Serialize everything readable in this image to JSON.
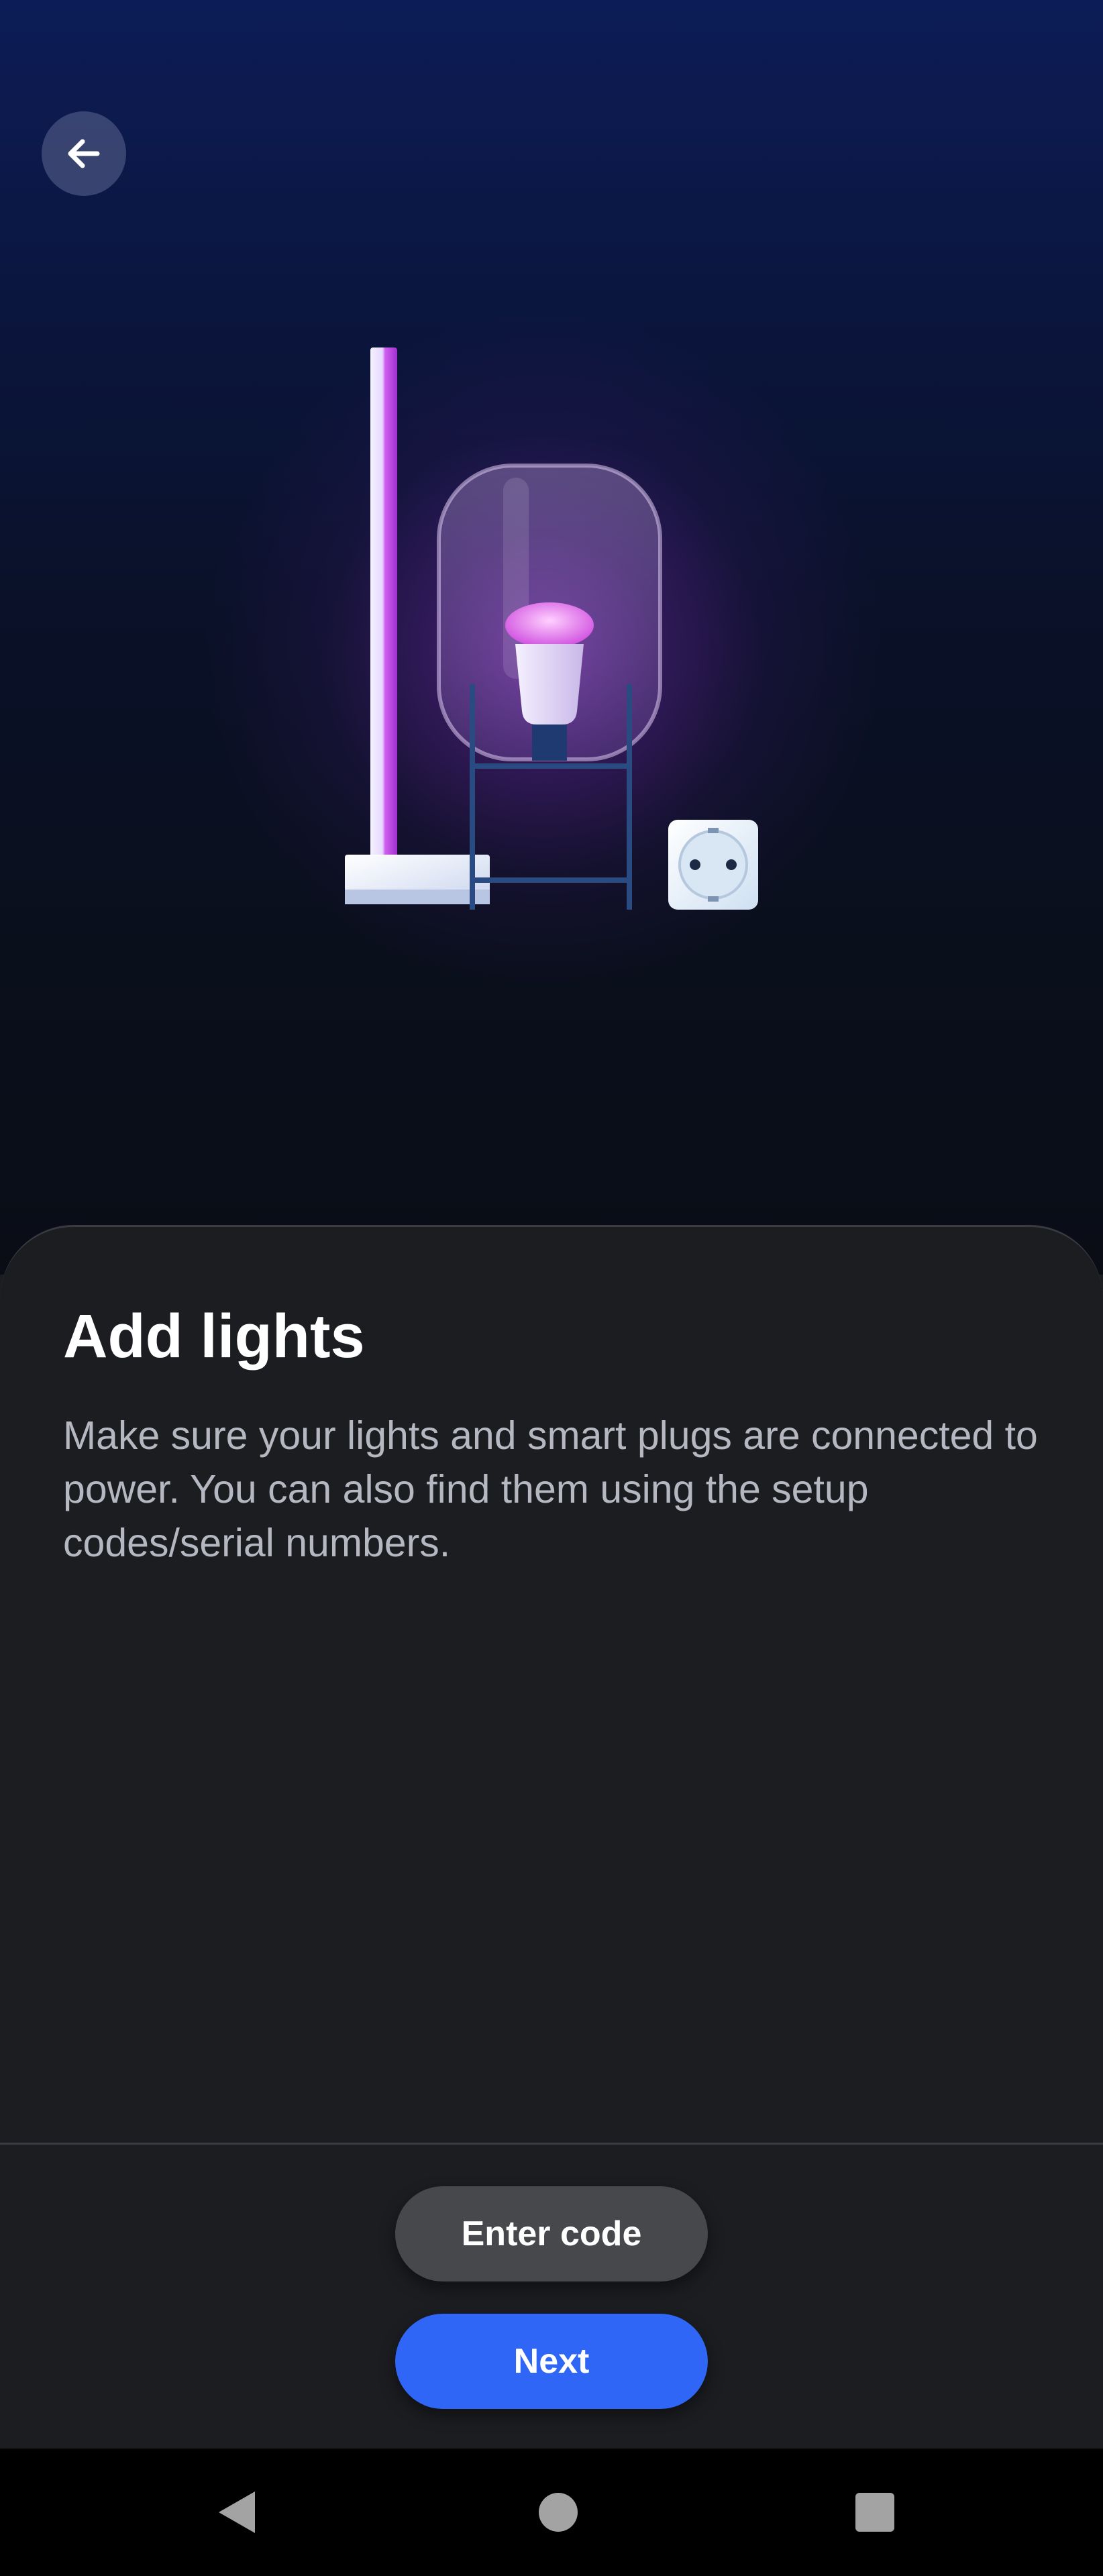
{
  "screen": {
    "title": "Add lights",
    "description": "Make sure your lights and smart plugs are connected to power. You can also find them using the setup codes/serial numbers."
  },
  "header": {
    "back_icon": "arrow-left-icon"
  },
  "illustration": {
    "items": [
      "light-bar-icon",
      "table-lamp-icon",
      "smart-plug-icon"
    ]
  },
  "actions": {
    "enter_code_label": "Enter code",
    "next_label": "Next"
  },
  "system_nav": {
    "icons": [
      "nav-back-icon",
      "nav-home-icon",
      "nav-recents-icon"
    ]
  },
  "colors": {
    "accent": "#2f66f5",
    "secondary_button": "#47484c",
    "sheet_background": "#1c1d21",
    "hero_top": "#0c1c56",
    "glow": "#b040e0"
  }
}
